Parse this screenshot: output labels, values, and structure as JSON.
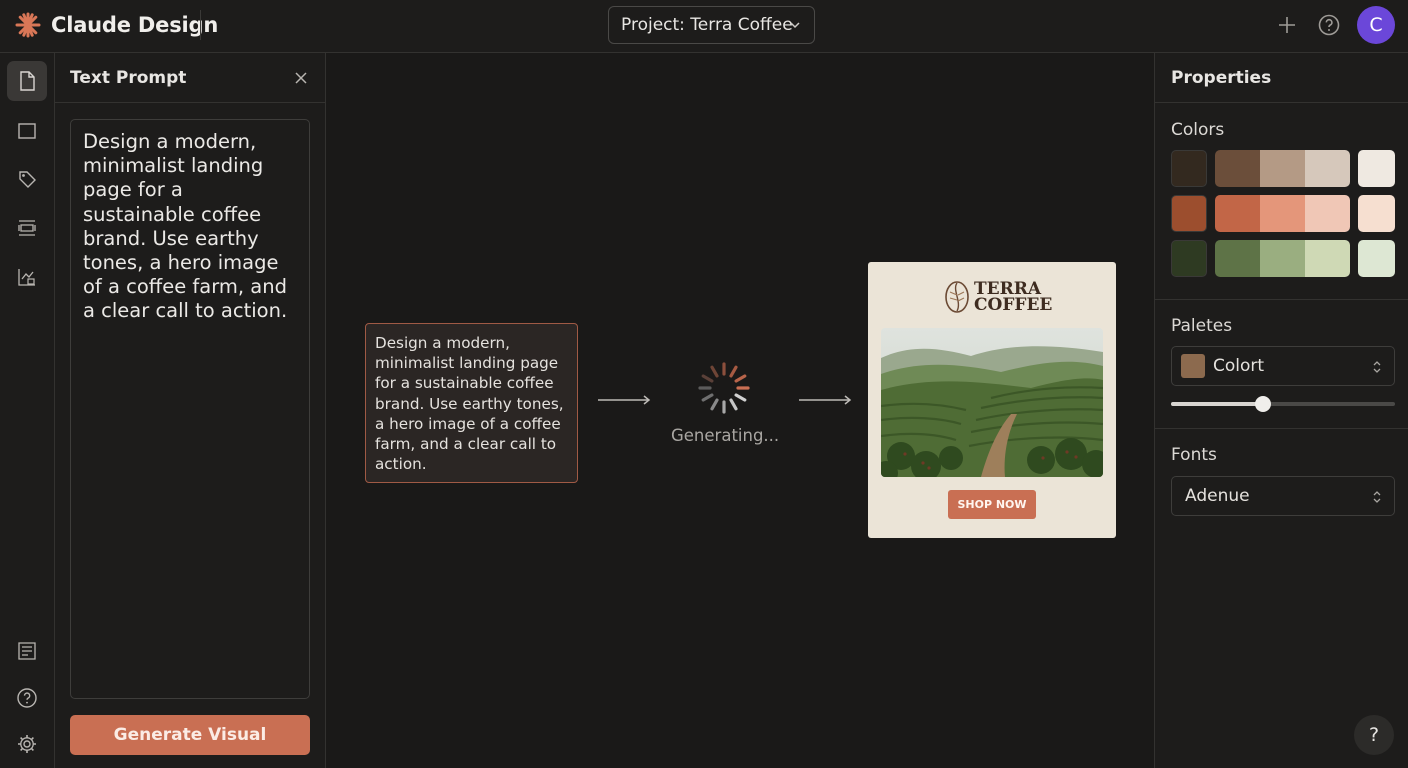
{
  "app": {
    "name": "Claude Design",
    "avatar_initial": "C"
  },
  "topbar": {
    "project": "Project: Terra Coffee"
  },
  "rail": {
    "items": [
      {
        "icon": "document-icon",
        "active": true
      },
      {
        "icon": "frame-icon",
        "active": false
      },
      {
        "icon": "shapes-icon",
        "active": false
      },
      {
        "icon": "components-icon",
        "active": false
      },
      {
        "icon": "assets-icon",
        "active": false
      }
    ],
    "bottom": [
      {
        "icon": "layers-icon"
      },
      {
        "icon": "help-icon"
      },
      {
        "icon": "gear-icon"
      }
    ]
  },
  "prompt_panel": {
    "title": "Text Prompt",
    "text": "Design a modern, minimalist landing page for a sustainable coffee brand. Use earthy tones, a hero image of a coffee farm, and a clear call to action.",
    "button": "Generate Visual"
  },
  "canvas": {
    "node_text": "Design a modern, minimalist landing page for a sustainable coffee brand. Use earthy tones, a hero image of a coffee farm, and a clear call to action.",
    "status": "Generating...",
    "preview": {
      "logo_line1": "TERRA",
      "logo_line2": "COFFEE",
      "cta": "SHOP NOW"
    }
  },
  "properties": {
    "title": "Properties",
    "colors_label": "Colors",
    "color_rows": [
      {
        "base": "#33291f",
        "shades": [
          "#6b4e3a",
          "#b49a85",
          "#d6c8bb"
        ],
        "light": "#efe9e1"
      },
      {
        "base": "#9c4e2e",
        "shades": [
          "#c26647",
          "#e4967a",
          "#f0c7b6"
        ],
        "light": "#f6dfd0"
      },
      {
        "base": "#2e3a22",
        "shades": [
          "#5e7347",
          "#9aae80",
          "#cfd9b5"
        ],
        "light": "#dde7d3"
      }
    ],
    "palettes_label": "Paletes",
    "palette_value": "Colort",
    "palette_slider": 0.41,
    "fonts_label": "Fonts",
    "font_value": "Adenue"
  },
  "help_fab": "?"
}
